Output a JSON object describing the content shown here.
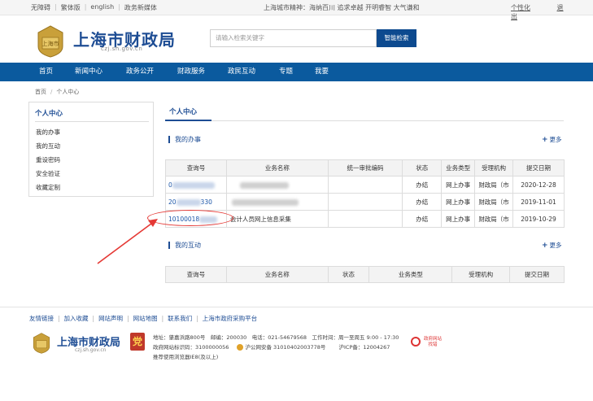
{
  "topbar": {
    "links": [
      "无障碍",
      "繁体版",
      "english",
      "政务新媒体"
    ],
    "motto": "上海城市精神：海纳百川 追求卓越 开明睿智 大气谦和",
    "right": [
      "个性化",
      "退出"
    ]
  },
  "header": {
    "title": "上海市财政局",
    "domain": "czj.sh.gov.cn",
    "logo_text": "上海市",
    "search_placeholder": "请输入检索关键字",
    "search_button": "智能检索"
  },
  "nav": [
    "首页",
    "新闻中心",
    "政务公开",
    "财政服务",
    "政民互动",
    "专题",
    "我要"
  ],
  "breadcrumb": [
    "首页",
    "个人中心"
  ],
  "sidebar": {
    "title": "个人中心",
    "items": [
      "我的办事",
      "我的互动",
      "重设密码",
      "安全验证",
      "收藏定制"
    ]
  },
  "main": {
    "tab": "个人中心",
    "more_label": "更多",
    "affairs": {
      "title": "我的办事",
      "headers": [
        "查询号",
        "业务名称",
        "统一审批编码",
        "状态",
        "业务类型",
        "受理机构",
        "提交日期"
      ],
      "rows": [
        {
          "num": "0",
          "name": "",
          "code": "",
          "status": "办结",
          "type": "网上办事",
          "org": "财政局（市",
          "date": "2020-12-28"
        },
        {
          "num": "20",
          "num_tail": "330",
          "name": "",
          "code": "",
          "status": "办结",
          "type": "网上办事",
          "org": "财政局（市",
          "date": "2019-11-01"
        },
        {
          "num": "10100018",
          "name": "会计人员网上信息采集",
          "code": "",
          "status": "办结",
          "type": "网上办事",
          "org": "财政局（市",
          "date": "2019-10-29"
        }
      ]
    },
    "interaction": {
      "title": "我的互动",
      "headers": [
        "查询号",
        "业务名称",
        "状态",
        "业务类型",
        "受理机构",
        "提交日期"
      ]
    }
  },
  "footer": {
    "links": [
      "友情链接",
      "加入收藏",
      "网站声明",
      "网站地图",
      "联系我们",
      "上海市政府采购平台"
    ],
    "title": "上海市财政局",
    "domain": "czj.sh.gov.cn",
    "badge": "党",
    "info_line1": "地址：肇嘉浜路800号　邮编：200030　电话：021-54679568　工作时间：周一至周五 9:00 - 17:30",
    "info_line2_a": "政府网站标识码：3100000056",
    "info_line2_b": "沪公网安备 31010402003778号",
    "info_line2_c": "沪ICP备：12004267",
    "info_line3": "推荐使用浏览器IE8(及以上)",
    "gov_badge": "政府网站 找错"
  },
  "colors": {
    "brand": "#1e4d94",
    "nav": "#0b5a9e",
    "annotation": "#e53935"
  }
}
